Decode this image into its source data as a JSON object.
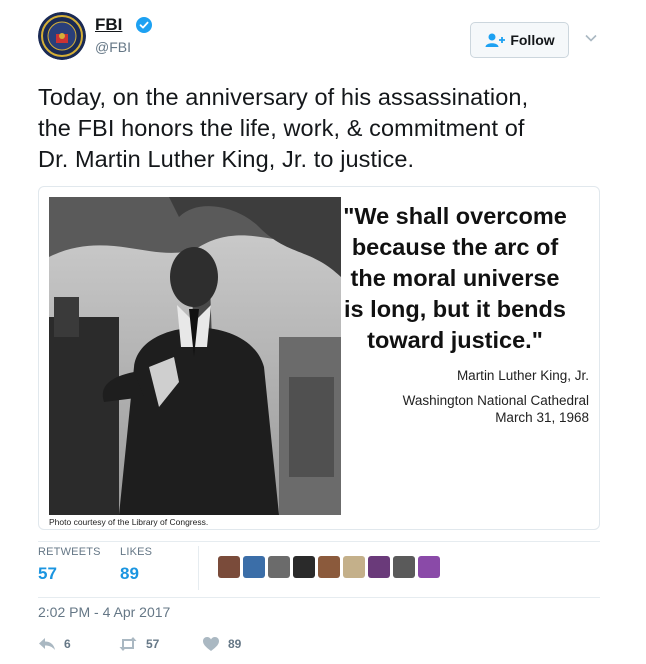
{
  "account": {
    "name": "FBI",
    "handle": "@FBI",
    "verified": true,
    "follow_label": "Follow"
  },
  "tweet": {
    "text_lines": [
      "Today, on the anniversary of his assassination,",
      "the FBI honors the life, work, & commitment of",
      "Dr. Martin Luther King, Jr. to justice."
    ]
  },
  "media": {
    "photo_credit": "Photo courtesy of the Library of Congress.",
    "quote_lines": [
      "\"We shall overcome",
      "because the arc of",
      "the moral universe",
      "is long, but it bends",
      "toward justice.\""
    ],
    "speaker": "Martin Luther King, Jr.",
    "venue": "Washington National Cathedral",
    "date": "March 31, 1968"
  },
  "stats": {
    "retweets_label": "RETWEETS",
    "retweets": "57",
    "likes_label": "LIKES",
    "likes": "89"
  },
  "timestamp": "2:02 PM - 4 Apr 2017",
  "actions": {
    "reply_count": "6",
    "retweet_count": "57",
    "like_count": "89"
  },
  "colors": {
    "accent": "#1b95e0",
    "muted": "#657786",
    "border": "#e6ecf0"
  }
}
